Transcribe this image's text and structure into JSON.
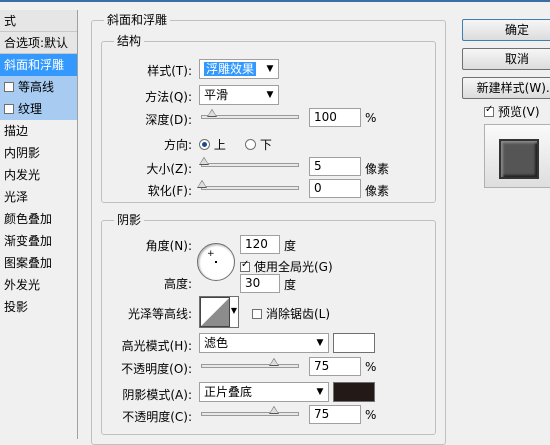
{
  "left_panel": {
    "items": [
      {
        "label": "式",
        "state": "header"
      },
      {
        "label": "合选项:默认",
        "state": "header"
      },
      {
        "label": "斜面和浮雕",
        "state": "selected"
      },
      {
        "label": "等高线",
        "state": "sub",
        "checked": false
      },
      {
        "label": "纹理",
        "state": "sub",
        "checked": false
      },
      {
        "label": "描边",
        "state": "normal"
      },
      {
        "label": "内阴影",
        "state": "normal"
      },
      {
        "label": "内发光",
        "state": "normal"
      },
      {
        "label": "光泽",
        "state": "normal"
      },
      {
        "label": "颜色叠加",
        "state": "normal"
      },
      {
        "label": "渐变叠加",
        "state": "normal"
      },
      {
        "label": "图案叠加",
        "state": "normal"
      },
      {
        "label": "外发光",
        "state": "normal"
      },
      {
        "label": "投影",
        "state": "normal"
      }
    ]
  },
  "bevel": {
    "title": "斜面和浮雕",
    "structure": {
      "title": "结构",
      "style_label": "样式(T):",
      "style_value": "浮雕效果",
      "technique_label": "方法(Q):",
      "technique_value": "平滑",
      "depth_label": "深度(D):",
      "depth_value": "100",
      "depth_unit": "%",
      "depth_level": 0.1,
      "direction_label": "方向:",
      "direction_up": "上",
      "direction_down": "下",
      "size_label": "大小(Z):",
      "size_value": "5",
      "size_unit": "像素",
      "size_level": 0.02,
      "soften_label": "软化(F):",
      "soften_value": "0",
      "soften_unit": "像素",
      "soften_level": 0.0
    },
    "shading": {
      "title": "阴影",
      "angle_label": "角度(N):",
      "angle_value": "120",
      "angle_unit": "度",
      "global_light_label": "使用全局光(G)",
      "global_light_checked": true,
      "altitude_label": "高度:",
      "altitude_value": "30",
      "altitude_unit": "度",
      "gloss_label": "光泽等高线:",
      "antialias_label": "消除锯齿(L)",
      "antialias_checked": false,
      "highlight_mode_label": "高光模式(H):",
      "highlight_mode_value": "滤色",
      "highlight_color": "#ffffff",
      "highlight_opacity_label": "不透明度(O):",
      "highlight_opacity_value": "75",
      "highlight_opacity_unit": "%",
      "highlight_opacity_level": 0.75,
      "shadow_mode_label": "阴影模式(A):",
      "shadow_mode_value": "正片叠底",
      "shadow_color": "#231a18",
      "shadow_opacity_label": "不透明度(C):",
      "shadow_opacity_value": "75",
      "shadow_opacity_unit": "%",
      "shadow_opacity_level": 0.75
    }
  },
  "buttons": {
    "ok": "确定",
    "cancel": "取消",
    "new_style": "新建样式(W)...",
    "preview_label": "预览(V)",
    "preview_checked": true
  },
  "colors": {
    "selection": "#3399ff",
    "sub_item": "#a8cbf2"
  }
}
